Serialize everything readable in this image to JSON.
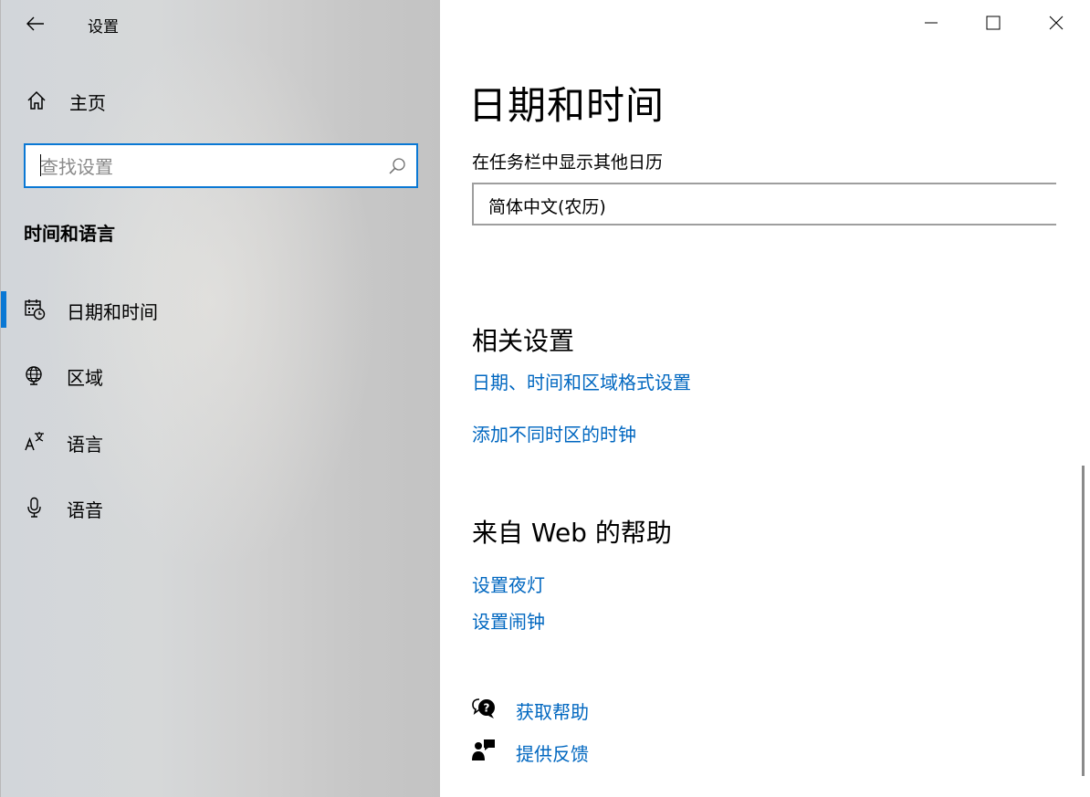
{
  "window": {
    "title": "设置"
  },
  "sidebar": {
    "home_label": "主页",
    "search_placeholder": "查找设置",
    "section_heading": "时间和语言",
    "items": [
      {
        "label": "日期和时间",
        "icon": "calendar-clock-icon",
        "active": true
      },
      {
        "label": "区域",
        "icon": "globe-icon",
        "active": false
      },
      {
        "label": "语言",
        "icon": "language-icon",
        "active": false
      },
      {
        "label": "语音",
        "icon": "microphone-icon",
        "active": false
      }
    ]
  },
  "main": {
    "title": "日期和时间",
    "calendar_label": "在任务栏中显示其他日历",
    "calendar_value": "简体中文(农历)",
    "related_heading": "相关设置",
    "related_links": [
      "日期、时间和区域格式设置",
      "添加不同时区的时钟"
    ],
    "web_help_heading": "来自 Web 的帮助",
    "web_help_links": [
      "设置夜灯",
      "设置闹钟"
    ],
    "get_help": "获取帮助",
    "feedback": "提供反馈"
  },
  "colors": {
    "accent": "#0a78d4",
    "link": "#0067c0"
  }
}
